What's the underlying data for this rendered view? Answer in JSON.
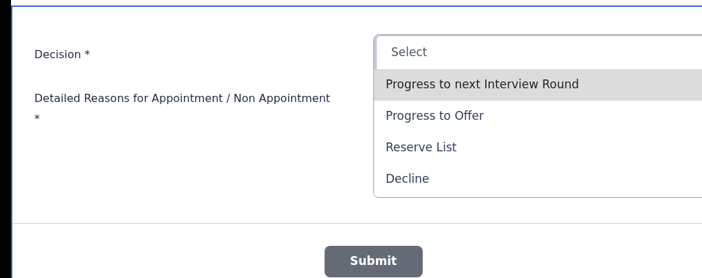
{
  "form": {
    "fields": [
      {
        "label": "Decision *"
      },
      {
        "label": "Detailed Reasons for Appointment / Non Appointment *"
      }
    ],
    "decision": {
      "placeholder": "Select",
      "options": [
        {
          "label": "Progress to next Interview Round",
          "selected": true
        },
        {
          "label": "Progress to Offer",
          "selected": false
        },
        {
          "label": "Reserve List",
          "selected": false
        },
        {
          "label": "Decline",
          "selected": false
        }
      ]
    },
    "submit": "Submit"
  }
}
